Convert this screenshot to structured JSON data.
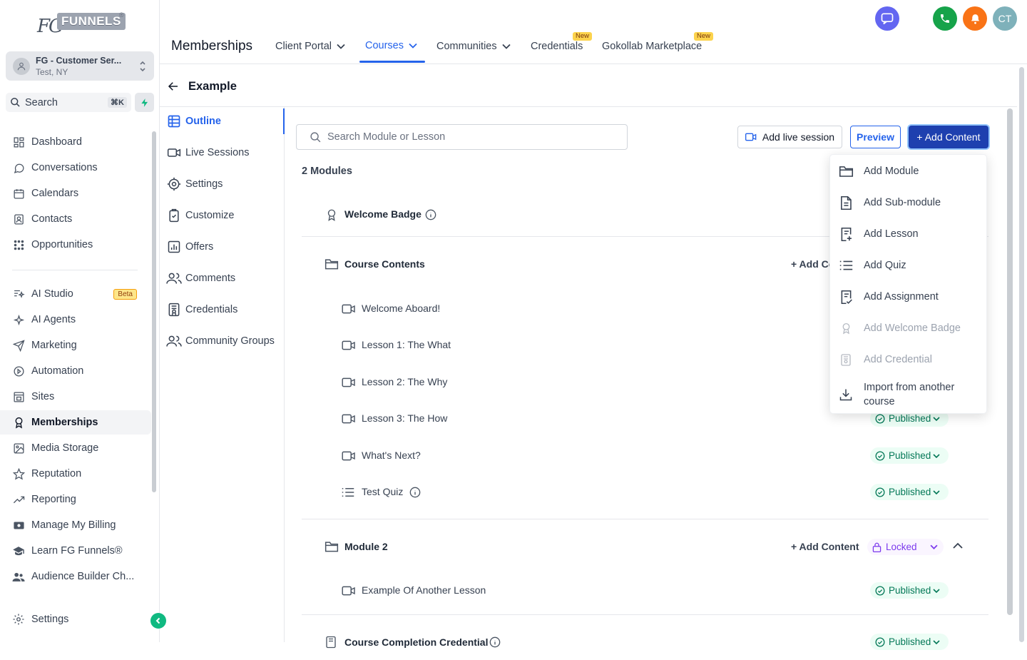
{
  "app": {
    "logo_fg": "FG",
    "logo_funnels": "FUNNELS",
    "logo_reg": "®"
  },
  "account": {
    "name": "FG - Customer Ser...",
    "location": "Test, NY"
  },
  "search": {
    "label": "Search",
    "shortcut": "⌘K"
  },
  "sidebar": {
    "items": [
      {
        "label": "Dashboard",
        "icon": "grid-icon"
      },
      {
        "label": "Conversations",
        "icon": "chat-icon"
      },
      {
        "label": "Calendars",
        "icon": "calendar-icon"
      },
      {
        "label": "Contacts",
        "icon": "contacts-icon"
      },
      {
        "label": "Opportunities",
        "icon": "opportunities-icon"
      },
      {
        "label": "AI Studio",
        "icon": "ai-studio-icon",
        "badge": "Beta"
      },
      {
        "label": "AI Agents",
        "icon": "sparkle-icon"
      },
      {
        "label": "Marketing",
        "icon": "send-icon"
      },
      {
        "label": "Automation",
        "icon": "automation-icon"
      },
      {
        "label": "Sites",
        "icon": "sites-icon"
      },
      {
        "label": "Memberships",
        "icon": "award-icon",
        "active": true
      },
      {
        "label": "Media Storage",
        "icon": "image-icon"
      },
      {
        "label": "Reputation",
        "icon": "star-icon"
      },
      {
        "label": "Reporting",
        "icon": "trend-icon"
      },
      {
        "label": "Manage My Billing",
        "icon": "money-icon"
      },
      {
        "label": "Learn FG Funnels®",
        "icon": "graduation-icon"
      },
      {
        "label": "Audience Builder Ch...",
        "icon": "users-icon"
      }
    ],
    "settings": "Settings"
  },
  "header": {
    "title": "Memberships",
    "tabs": [
      {
        "label": "Client Portal",
        "dropdown": true
      },
      {
        "label": "Courses",
        "dropdown": true,
        "active": true
      },
      {
        "label": "Communities",
        "dropdown": true
      },
      {
        "label": "Credentials",
        "badge": "New"
      },
      {
        "label": "Gokollab Marketplace",
        "badge": "New"
      }
    ],
    "user_initials": "CT"
  },
  "course": {
    "title": "Example"
  },
  "subnav": [
    {
      "label": "Outline",
      "active": true
    },
    {
      "label": "Live Sessions"
    },
    {
      "label": "Settings"
    },
    {
      "label": "Customize"
    },
    {
      "label": "Offers"
    },
    {
      "label": "Comments"
    },
    {
      "label": "Credentials"
    },
    {
      "label": "Community Groups"
    }
  ],
  "main": {
    "search_placeholder": "Search Module or Lesson",
    "btn_live": "Add live session",
    "btn_preview": "Preview",
    "btn_add": "+ Add Content",
    "module_count": "2 Modules",
    "welcome_badge": "Welcome Badge",
    "module1": {
      "title": "Course Contents",
      "add": "+ Add Co"
    },
    "lessons": [
      {
        "title": "Welcome Aboard!",
        "icon": "video-icon"
      },
      {
        "title": "Lesson 1: The What",
        "icon": "video-icon"
      },
      {
        "title": "Lesson 2: The Why",
        "icon": "video-icon"
      },
      {
        "title": "Lesson 3: The How",
        "icon": "video-icon",
        "status": "Published"
      },
      {
        "title": "What's Next?",
        "icon": "video-icon",
        "status": "Published"
      },
      {
        "title": "Test Quiz",
        "icon": "quiz-icon",
        "status": "Published"
      }
    ],
    "module2": {
      "title": "Module 2",
      "add": "+ Add Content",
      "status": "Locked"
    },
    "module2_lessons": [
      {
        "title": "Example Of Another Lesson",
        "status": "Published"
      }
    ],
    "credential_row": {
      "title": "Course Completion Credential",
      "status": "Published"
    }
  },
  "dropdown": {
    "items": [
      {
        "label": "Add Module",
        "icon": "folder-icon",
        "disabled": false
      },
      {
        "label": "Add Sub-module",
        "icon": "document-icon",
        "disabled": false
      },
      {
        "label": "Add Lesson",
        "icon": "lesson-add-icon",
        "disabled": false
      },
      {
        "label": "Add Quiz",
        "icon": "list-icon",
        "disabled": false
      },
      {
        "label": "Add Assignment",
        "icon": "assignment-icon",
        "disabled": false
      },
      {
        "label": "Add Welcome Badge",
        "icon": "award-icon",
        "disabled": true
      },
      {
        "label": "Add Credential",
        "icon": "credential-icon",
        "disabled": true
      },
      {
        "label": "Import from another course",
        "icon": "download-icon",
        "disabled": false
      }
    ]
  },
  "colors": {
    "accent": "#2563eb",
    "primary_button": "#1e40af",
    "published": "#047857",
    "locked": "#7c3aed"
  }
}
